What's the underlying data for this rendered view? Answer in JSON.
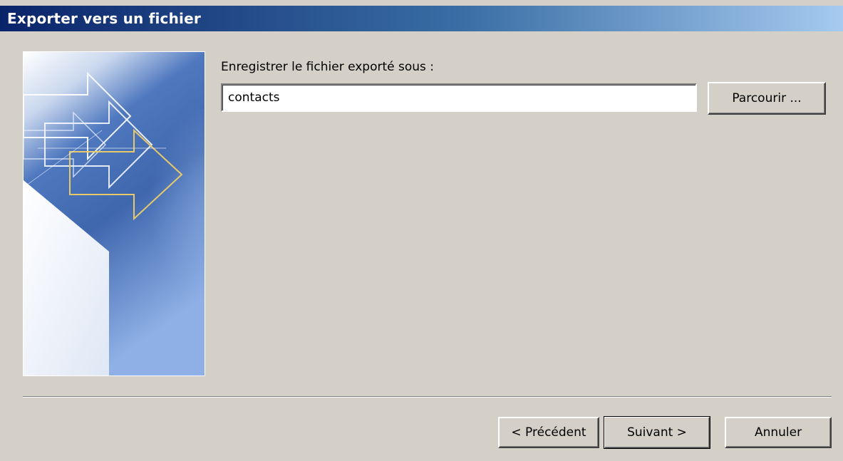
{
  "window": {
    "title": "Exporter vers un fichier"
  },
  "main": {
    "prompt_label": "Enregistrer le fichier exporté sous :",
    "filename_value": "contacts",
    "browse_label": "Parcourir ..."
  },
  "footer": {
    "prev_label": "< Précédent",
    "next_label": "Suivant >",
    "cancel_label": "Annuler"
  },
  "side_image": {
    "icon": "export-arrows-illustration"
  },
  "colors": {
    "title_gradient_start": "#0a246a",
    "title_gradient_end": "#a6caf0",
    "dialog_background": "#d4d0c8",
    "arrow_accent": "#e8c96a"
  }
}
